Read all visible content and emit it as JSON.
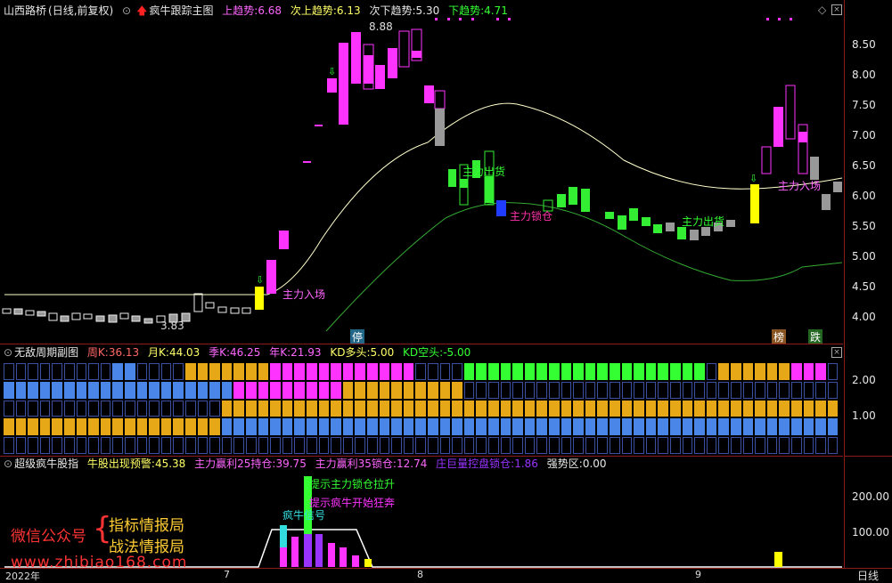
{
  "colors": {
    "magenta": "#ff33ff",
    "green": "#33ff33",
    "gray": "#808080",
    "yellow": "#ffff00",
    "red": "#ff3333",
    "orange": "#e6a817",
    "blue": "#4a86e8",
    "pink": "#ff66cc",
    "purple": "#9933ff",
    "cyan": "#33dddd"
  },
  "main": {
    "stock_name": "山西路桥",
    "period_label": "(日线,前复权)",
    "indicator_name": "疯牛跟踪主图",
    "up_trend_label": "上趋势:",
    "up_trend_value": "6.68",
    "sub_up_label": "次上趋势:",
    "sub_up_value": "6.13",
    "sub_down_label": "次下趋势:",
    "sub_down_value": "5.30",
    "down_trend_label": "下趋势:",
    "down_trend_value": "4.71",
    "annotations": {
      "enter": "主力入场",
      "ship": "主力出货",
      "lock": "主力锁仓",
      "ship2": "主力出货",
      "enter2": "主力入场",
      "high": "8.88",
      "low": "3.83"
    },
    "badges": {
      "stop": "停",
      "bang": "榜",
      "fall": "跌"
    },
    "yticks": [
      "8.50",
      "8.00",
      "7.50",
      "7.00",
      "6.50",
      "6.00",
      "5.50",
      "5.00",
      "4.50",
      "4.00"
    ]
  },
  "sub1": {
    "name": "无敌周期副图",
    "week_label": "周K:",
    "week_value": "36.13",
    "month_label": "月K:",
    "month_value": "44.03",
    "season_label": "季K:",
    "season_value": "46.25",
    "year_label": "年K:",
    "year_value": "21.93",
    "kd_long_label": "KD多头:",
    "kd_long_value": "5.00",
    "kd_short_label": "KD空头:",
    "kd_short_value": "-5.00",
    "yticks": [
      "2.00",
      "1.00"
    ]
  },
  "sub2": {
    "name": "超级疯牛股指",
    "warn_label": "牛股出现预警:",
    "warn_value": "45.38",
    "profit25_label": "主力赢利25持仓:",
    "profit25_value": "39.75",
    "profit35_label": "主力赢利35锁仓:",
    "profit35_value": "12.74",
    "huge_label": "庄巨量控盘锁仓:",
    "huge_value": "1.86",
    "strong_label": "强势区:",
    "strong_value": "0.00",
    "notes": {
      "lock_up": "提示主力锁仓拉升",
      "crazy": "提示疯牛开始狂奔",
      "signal": "疯牛信号"
    },
    "yticks": [
      "200.00",
      "100.00"
    ]
  },
  "watermark": {
    "wechat": "微信公众号",
    "line1": "指标情报局",
    "line2": "战法情报局",
    "url": "www.zhibiao168.com"
  },
  "xaxis": {
    "year": "2022年",
    "m7": "7",
    "m8": "8",
    "m9": "9",
    "period_btn": "日线"
  }
}
